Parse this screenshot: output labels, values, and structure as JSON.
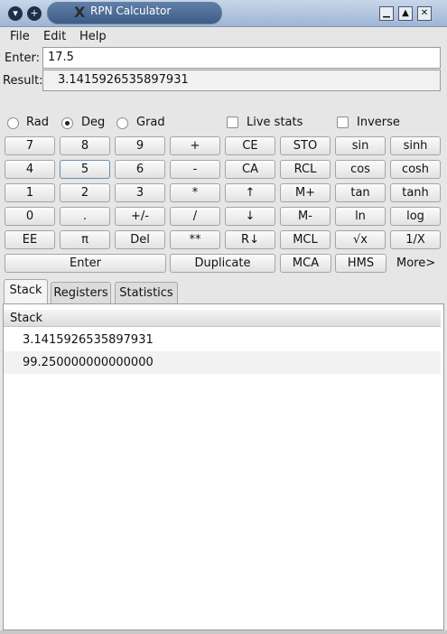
{
  "window": {
    "title": "RPN Calculator"
  },
  "menu": [
    "File",
    "Edit",
    "Help"
  ],
  "enter": {
    "label": "Enter:",
    "value": "17.5"
  },
  "result": {
    "label": "Result:",
    "value": "3.1415926535897931"
  },
  "angle_modes": [
    {
      "label": "Rad",
      "selected": false
    },
    {
      "label": "Deg",
      "selected": true
    },
    {
      "label": "Grad",
      "selected": false
    }
  ],
  "options": [
    {
      "label": "Live stats",
      "checked": false
    },
    {
      "label": "Inverse",
      "checked": false
    }
  ],
  "keys": [
    [
      "7",
      "8",
      "9",
      "+",
      "CE",
      "STO",
      "sin",
      "sinh"
    ],
    [
      "4",
      "5",
      "6",
      "-",
      "CA",
      "RCL",
      "cos",
      "cosh"
    ],
    [
      "1",
      "2",
      "3",
      "*",
      "↑",
      "M+",
      "tan",
      "tanh"
    ],
    [
      "0",
      ".",
      "+/-",
      "/",
      "↓",
      "M-",
      "ln",
      "log"
    ],
    [
      "EE",
      "π",
      "Del",
      "**",
      "R↓",
      "MCL",
      "√x",
      "1/X"
    ]
  ],
  "bottom_keys": {
    "enter": "Enter",
    "duplicate": "Duplicate",
    "mca": "MCA",
    "hms": "HMS",
    "more": "More>"
  },
  "tabs": [
    "Stack",
    "Registers",
    "Statistics"
  ],
  "stack": {
    "header": "Stack",
    "values": [
      "3.1415926535897931",
      "99.250000000000000"
    ]
  }
}
